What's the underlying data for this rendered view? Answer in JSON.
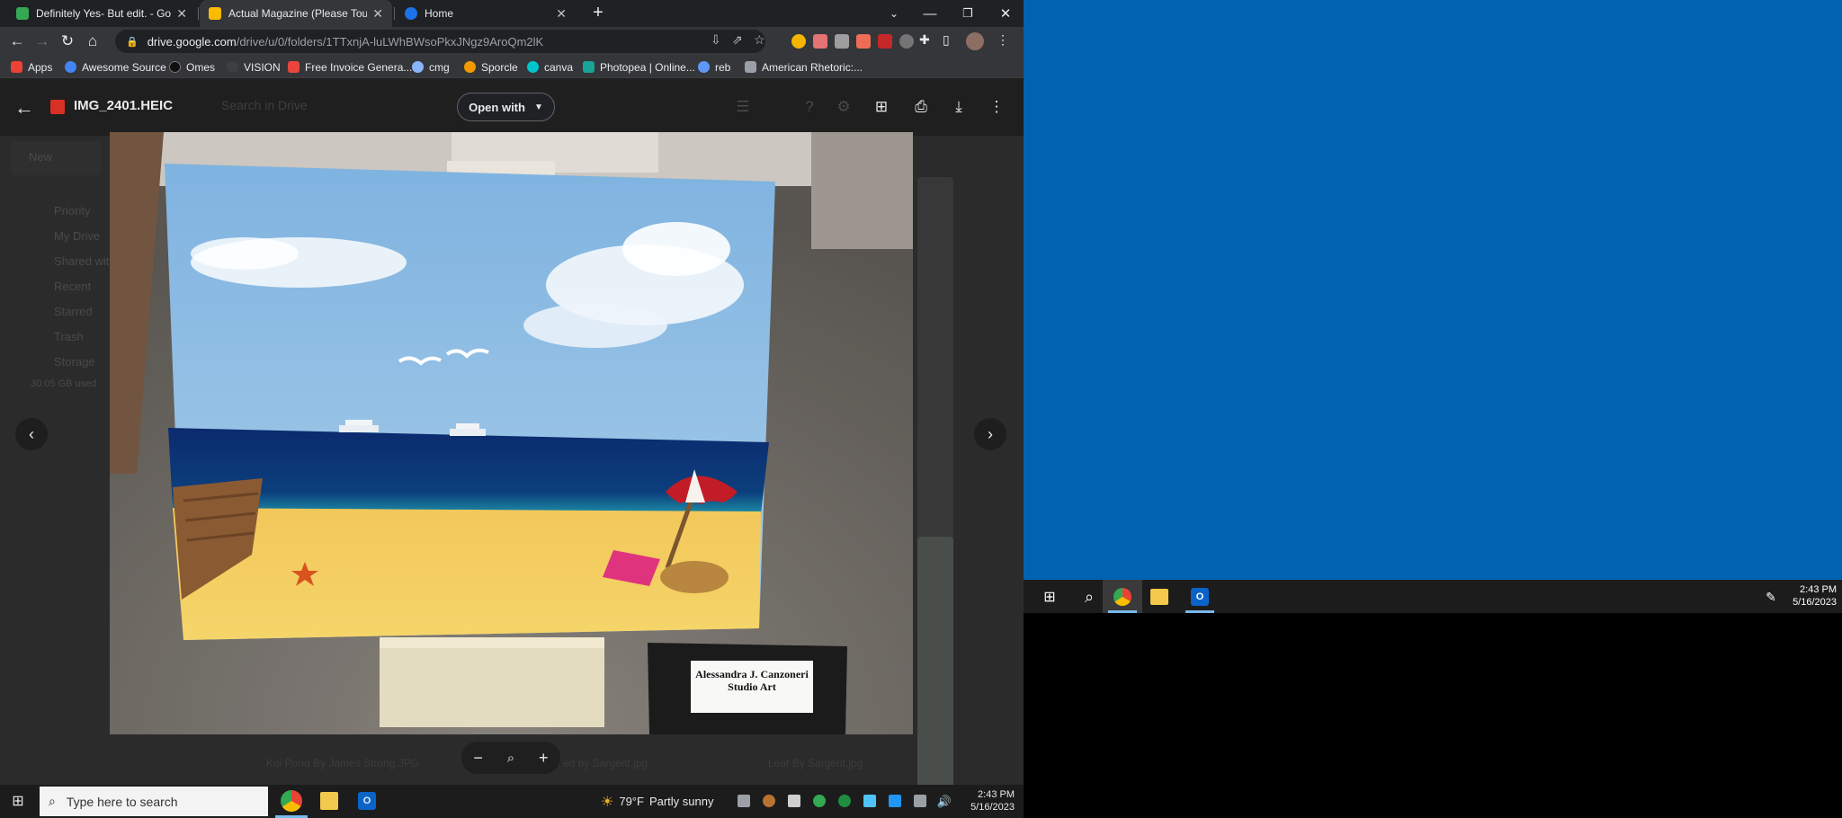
{
  "browser": {
    "tabs": [
      {
        "title": "Definitely Yes- But edit. - Google",
        "active": false,
        "icon_color": "#34a853"
      },
      {
        "title": "Actual Magazine (Please Touch)",
        "active": true,
        "icon_color": "#fbbc04"
      },
      {
        "title": "Home",
        "active": false,
        "icon_color": "#8ab4f8"
      }
    ],
    "new_tab": "+",
    "url_host": "drive.google.com",
    "url_path": "/drive/u/0/folders/1TTxnjA-luLWhBWsoPkxJNgz9AroQm2lK",
    "bookmarks": [
      {
        "label": "Apps",
        "color": "#ea4335"
      },
      {
        "label": "Awesome Source",
        "color": "#4285f4"
      },
      {
        "label": "Omes",
        "color": "#111111"
      },
      {
        "label": "VISION",
        "color": "#3c4043"
      },
      {
        "label": "Free Invoice Genera...",
        "color": "#e8453c"
      },
      {
        "label": "cmg",
        "color": "#8ab4f8"
      },
      {
        "label": "Sporcle",
        "color": "#f29900"
      },
      {
        "label": "canva",
        "color": "#00c4cc"
      },
      {
        "label": "Photopea | Online...",
        "color": "#18a497"
      },
      {
        "label": "reb",
        "color": "#5e97f6"
      },
      {
        "label": "American Rhetoric:...",
        "color": "#9aa0a6"
      }
    ]
  },
  "viewer": {
    "file_name": "IMG_2401.HEIC",
    "search_placeholder": "Search in Drive",
    "open_with": "Open with",
    "side_items": [
      "New",
      "Priority",
      "My Drive",
      "Shared with me",
      "Recent",
      "Starred",
      "Trash",
      "Storage",
      "30.05 GB used"
    ],
    "ghost_files": [
      "Koi Pond By James Strong.JPG",
      "ed by Sargent.jpg",
      "Leaf By Sargent.jpg"
    ]
  },
  "painting": {
    "label_line1": "Alessandra J. Canzoneri",
    "label_line2": "Studio Art"
  },
  "taskbar": {
    "search_placeholder": "Type here to search",
    "weather_temp": "79°F",
    "weather_desc": "Partly sunny",
    "time": "2:43 PM",
    "date": "5/16/2023"
  },
  "desktop_taskbar": {
    "time": "2:43 PM",
    "date": "5/16/2023"
  }
}
